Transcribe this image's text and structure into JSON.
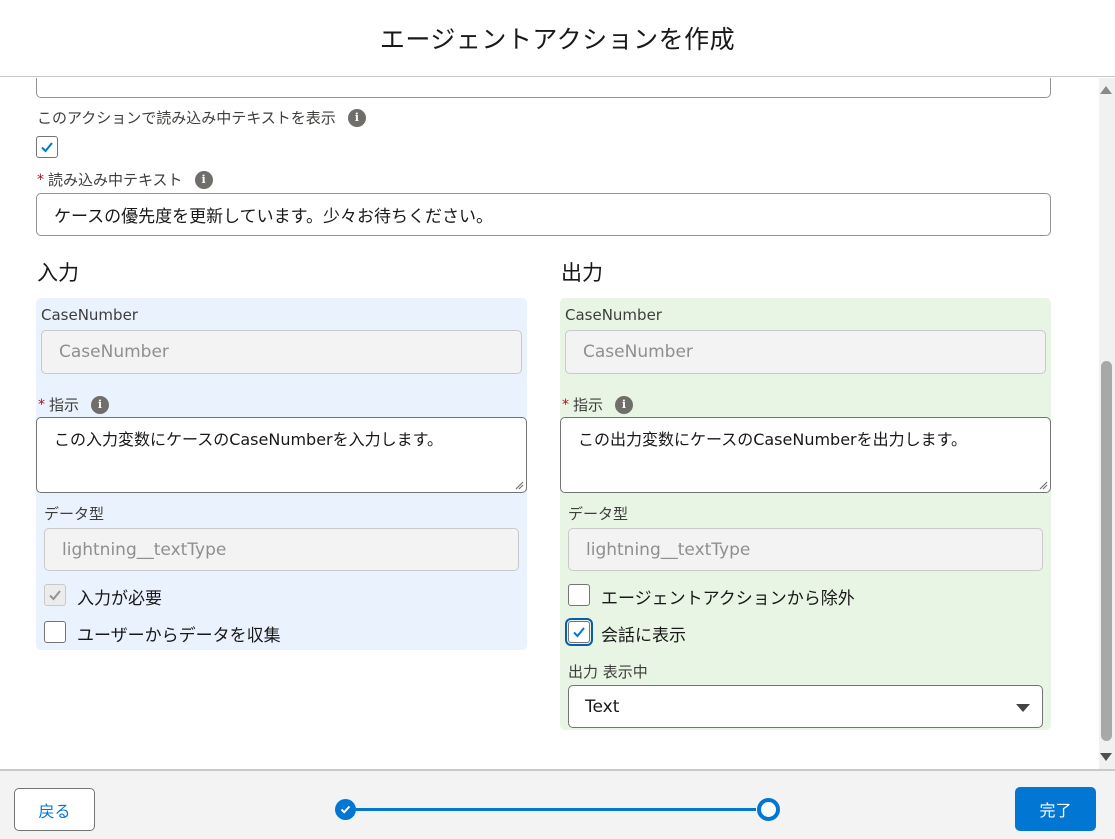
{
  "header": {
    "title": "エージェントアクションを作成"
  },
  "loading": {
    "show_label": "このアクションで読み込み中テキストを表示",
    "show_checked": true,
    "text_label": "読み込み中テキスト",
    "text_value": "ケースの優先度を更新しています。少々お待ちください。"
  },
  "input_section": {
    "title": "入力",
    "param_label": "CaseNumber",
    "param_value": "CaseNumber",
    "instruction_label": "指示",
    "instruction_value": "この入力変数にケースのCaseNumberを入力します。",
    "datatype_label": "データ型",
    "datatype_value": "lightning__textType",
    "required_label": "入力が必要",
    "required_checked": true,
    "collect_label": "ユーザーからデータを収集",
    "collect_checked": false
  },
  "output_section": {
    "title": "出力",
    "param_label": "CaseNumber",
    "param_value": "CaseNumber",
    "instruction_label": "指示",
    "instruction_value": "この出力変数にケースのCaseNumberを出力します。",
    "datatype_label": "データ型",
    "datatype_value": "lightning__textType",
    "exclude_label": "エージェントアクションから除外",
    "exclude_checked": false,
    "show_label": "会話に表示",
    "show_checked": true,
    "render_label": "出力 表示中",
    "render_value": "Text"
  },
  "footer": {
    "back_label": "戻る",
    "done_label": "完了",
    "progress_current_step": 2,
    "progress_total_steps": 2
  },
  "colors": {
    "brand": "#0176d3",
    "input_panel": "#eaf2fd",
    "output_panel": "#e8f4e4",
    "required": "#ba0517"
  }
}
